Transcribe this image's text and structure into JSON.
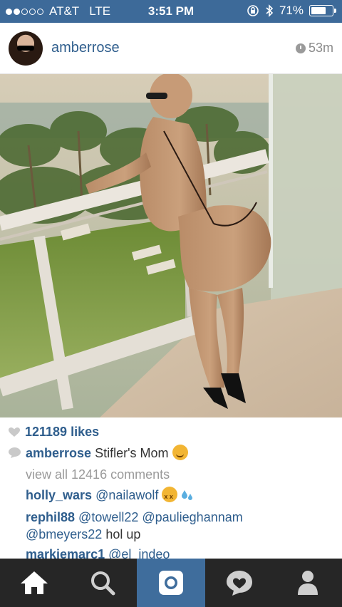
{
  "status_bar": {
    "carrier": "AT&T",
    "network": "LTE",
    "time": "3:51 PM",
    "battery_text": "71%",
    "battery_level": 0.71,
    "signal_dots_filled": 2,
    "signal_dots_total": 5
  },
  "post": {
    "username": "amberrose",
    "time_ago": "53m",
    "photo_icon": "photo-image",
    "likes": "121189 likes",
    "caption_user": "amberrose",
    "caption_text": "Stifler's Mom",
    "view_all_comments": "view all 12416 comments",
    "comments": [
      {
        "user": "holly_wars",
        "mention": "@nailawolf"
      },
      {
        "user": "rephil88",
        "mentions": "@towell22 @paulieghannam",
        "line2_mention": "@bmeyers22",
        "line2_text": " hol up"
      },
      {
        "user": "markiemarc1",
        "mention": "@el_indeo"
      }
    ]
  },
  "tab_bar": {
    "items": [
      {
        "name": "home",
        "icon": "home-icon",
        "active": false
      },
      {
        "name": "search",
        "icon": "search-icon",
        "active": false
      },
      {
        "name": "camera",
        "icon": "camera-icon",
        "active": true
      },
      {
        "name": "activity",
        "icon": "heart-bubble-icon",
        "active": false
      },
      {
        "name": "profile",
        "icon": "profile-icon",
        "active": false
      }
    ]
  },
  "colors": {
    "status_bar_bg": "#3d6a99",
    "link_blue": "#2f5e8d",
    "tab_bar_bg": "#262626",
    "tab_active_bg": "#3f6d9c"
  }
}
